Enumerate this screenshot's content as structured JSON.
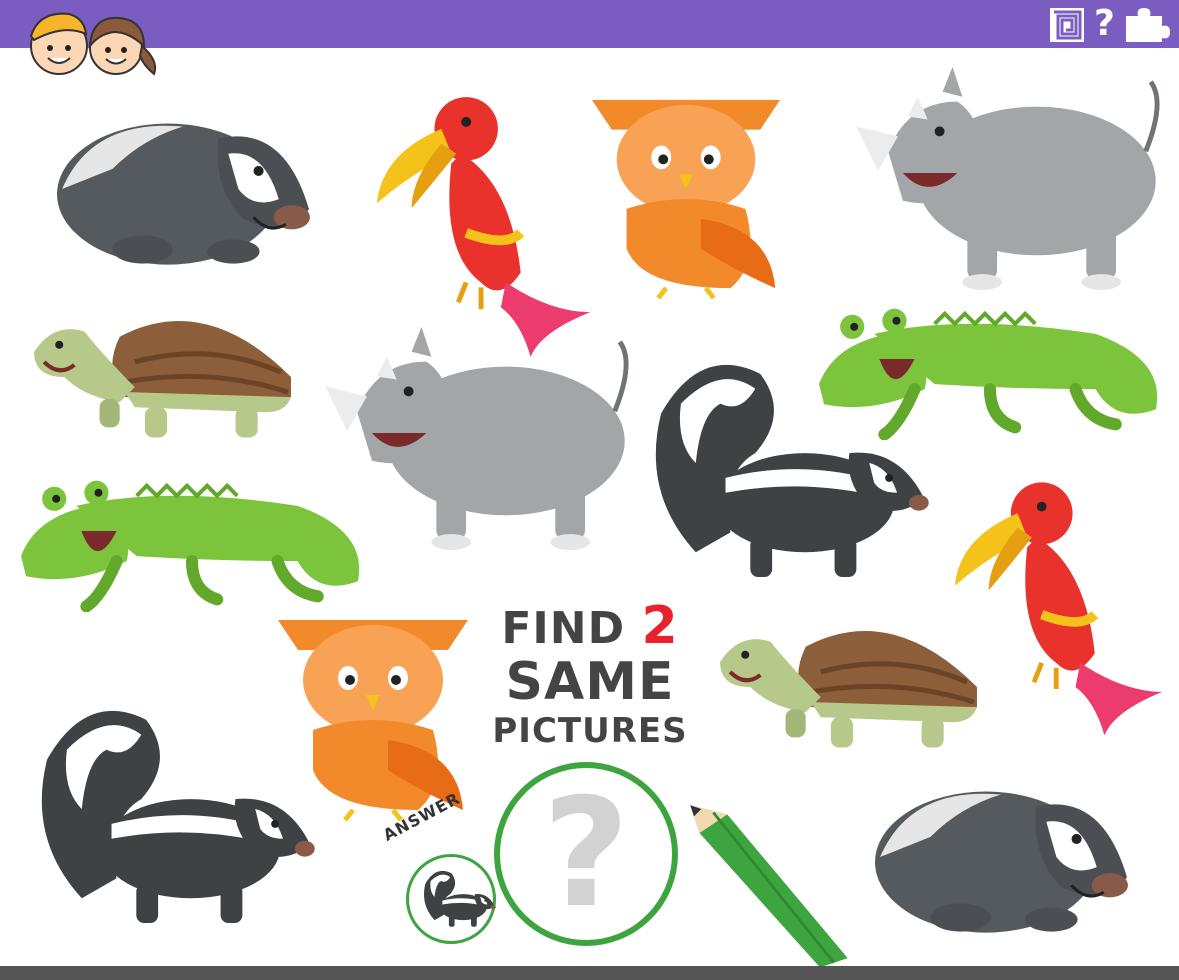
{
  "title": {
    "find": "FIND",
    "count": "2",
    "same": "SAME",
    "pictures": "PICTURES"
  },
  "answer": {
    "label": "ANSWER",
    "placeholder": "?"
  },
  "toolbar": {
    "help": "?"
  },
  "colors": {
    "top_bar": "#7b5cc0",
    "accent": "#e8212d",
    "circle": "#3da43f"
  }
}
